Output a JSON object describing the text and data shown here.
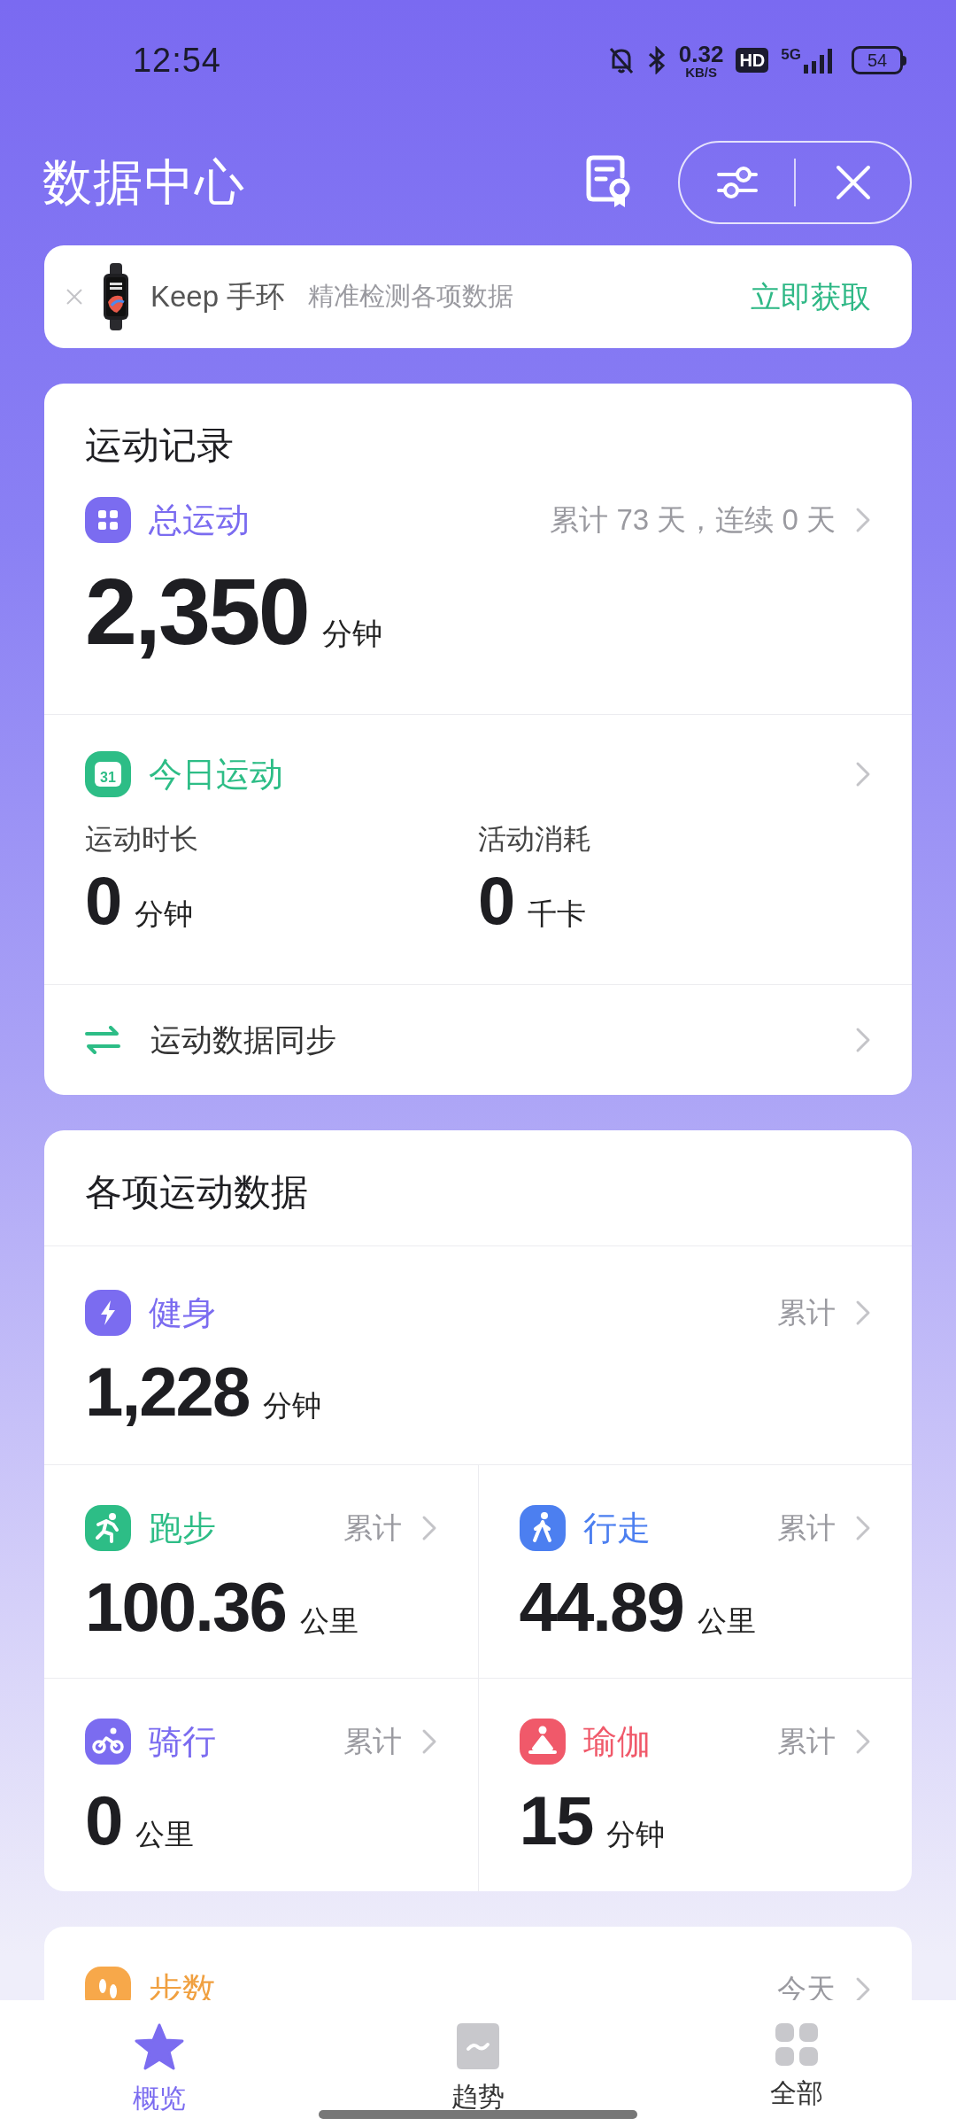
{
  "status_bar": {
    "time": "12:54",
    "net_speed": "0.32",
    "net_unit": "KB/S",
    "hd": "HD",
    "network": "5G",
    "battery": "54"
  },
  "header": {
    "title": "数据中心"
  },
  "banner": {
    "product": "Keep 手环",
    "tagline": "精准检测各项数据",
    "action": "立即获取"
  },
  "record_card": {
    "title": "运动记录",
    "total": {
      "label": "总运动",
      "summary": "累计 73 天，连续 0 天",
      "value": "2,350",
      "unit": "分钟"
    },
    "today": {
      "label": "今日运动",
      "icon_text": "31",
      "stats": [
        {
          "label": "运动时长",
          "value": "0",
          "unit": "分钟"
        },
        {
          "label": "活动消耗",
          "value": "0",
          "unit": "千卡"
        }
      ]
    },
    "sync": {
      "label": "运动数据同步"
    }
  },
  "sports_card": {
    "title": "各项运动数据",
    "items": [
      {
        "kind": "fitness",
        "label": "健身",
        "note": "累计",
        "value": "1,228",
        "unit": "分钟",
        "color": "#7b6cf0"
      },
      {
        "kind": "running",
        "label": "跑步",
        "note": "累计",
        "value": "100.36",
        "unit": "公里",
        "color": "#2dbd86"
      },
      {
        "kind": "walking",
        "label": "行走",
        "note": "累计",
        "value": "44.89",
        "unit": "公里",
        "color": "#4c7ff0"
      },
      {
        "kind": "cycling",
        "label": "骑行",
        "note": "累计",
        "value": "0",
        "unit": "公里",
        "color": "#7b6cf0"
      },
      {
        "kind": "yoga",
        "label": "瑜伽",
        "note": "累计",
        "value": "15",
        "unit": "分钟",
        "color": "#f0596a"
      }
    ]
  },
  "steps_card": {
    "label": "步数",
    "note": "今天"
  },
  "bottom_nav": [
    {
      "kind": "overview",
      "label": "概览",
      "selected": true
    },
    {
      "kind": "trend",
      "label": "趋势",
      "selected": false
    },
    {
      "kind": "all",
      "label": "全部",
      "selected": false
    }
  ]
}
